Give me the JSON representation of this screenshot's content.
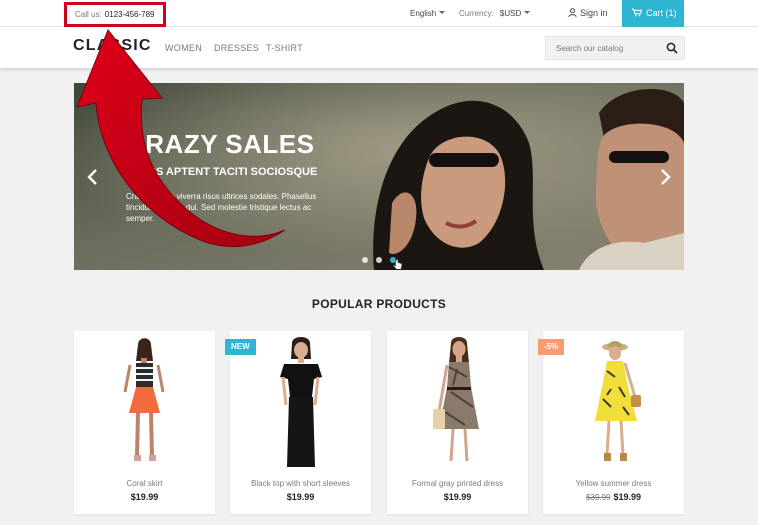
{
  "topbar": {
    "call_label": "Call us:",
    "phone": "0123-456-789",
    "language": "English",
    "currency_label": "Currency:",
    "currency": "$USD",
    "sign_in": "Sign in",
    "cart": "Cart (1)"
  },
  "header": {
    "logo": "CLASSIC",
    "nav": [
      "WOMEN",
      "DRESSES",
      "T-SHIRT"
    ],
    "search_placeholder": "Search our catalog"
  },
  "slider": {
    "title": "CRAZY SALES",
    "subtitle": "CLASS APTENT TACITI SOCIOSQUE",
    "text": "Cras vehicula viverra risus ultrices sodales. Phasellus tincidunt efficitur dui. Sed molestie tristique lectus ac semper.",
    "dots": 3,
    "active_dot": 3
  },
  "section_title": "POPULAR PRODUCTS",
  "products": [
    {
      "name": "Coral skirt",
      "price": "$19.99",
      "old_price": "",
      "flag": ""
    },
    {
      "name": "Black top with short sleeves",
      "price": "$19.99",
      "old_price": "",
      "flag": "NEW"
    },
    {
      "name": "Formal gray printed dress",
      "price": "$19.99",
      "old_price": "",
      "flag": ""
    },
    {
      "name": "Yellow summer dress",
      "price": "$19.99",
      "old_price": "$39.99",
      "flag": "-5%"
    }
  ],
  "colors": {
    "accent": "#2fb5d2",
    "highlight": "#d0021b",
    "discount": "#f39d72"
  }
}
